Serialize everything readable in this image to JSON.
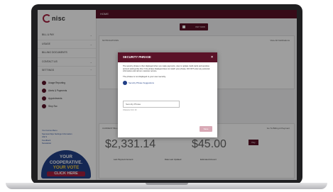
{
  "sidebar": {
    "logo_text": "nisc",
    "nav": [
      {
        "label": "BILL & PAY",
        "chevron": "⌄"
      },
      {
        "label": "USAGE",
        "chevron": "⌄"
      },
      {
        "label": "BILLING DOCUMENTS",
        "chevron": ""
      },
      {
        "label": "CONTACT US",
        "chevron": "⌄"
      },
      {
        "label": "SETTINGS",
        "chevron": "⌃"
      }
    ],
    "settings_items": [
      {
        "label": "Usage Reporting"
      },
      {
        "label": "Alerts & Payments"
      },
      {
        "label": "Appointments"
      },
      {
        "label": "Stop Svc"
      }
    ],
    "links": [
      "Your Home Menu",
      "Sponsorships Settings Information",
      "A/E S",
      "Feedback",
      "Newsletter"
    ],
    "promo": {
      "line1": "YOUR",
      "line2": "COOPERATIVE.",
      "line3": "YOUR VOTE",
      "line4": "CLICK HERE"
    }
  },
  "topbar": {
    "title": "HOME"
  },
  "content": {
    "pay_now_button": "PAY NOW",
    "notifications_header": "NOTIFICATIONS",
    "notifications_link": "View All Notifications",
    "account_header": "CURRENT BILL",
    "account_link": "Go To Billing & Payment",
    "balance": "$2,331.14",
    "amount_due": "$45.00",
    "balance_label": "Last Payment Amount",
    "date_label": "Date Last Updated",
    "due_label": "Estimated Amount",
    "pay_button": "Pay"
  },
  "modal": {
    "title": "SECURITY PHRASE",
    "close_glyph": "×",
    "paragraph": "The security phrase is then displayed when you make payments, view or update credit cards and sensitive account settings like this. If the phrase displayed does not match your phrase, DO NOT enter any personal information and call our customer service.",
    "paragraph_note": "The phrase is not displayed to your user security.",
    "radio_label": "Security Phrase Suggestions",
    "field_placeholder": "Security Phrase",
    "field_hint": "Character limit: 20",
    "save_button": "Save"
  },
  "colors": {
    "brand": "#5a1228",
    "accent": "#a41d3e",
    "link": "#213f86",
    "promo_yellow": "#ffd23e"
  }
}
